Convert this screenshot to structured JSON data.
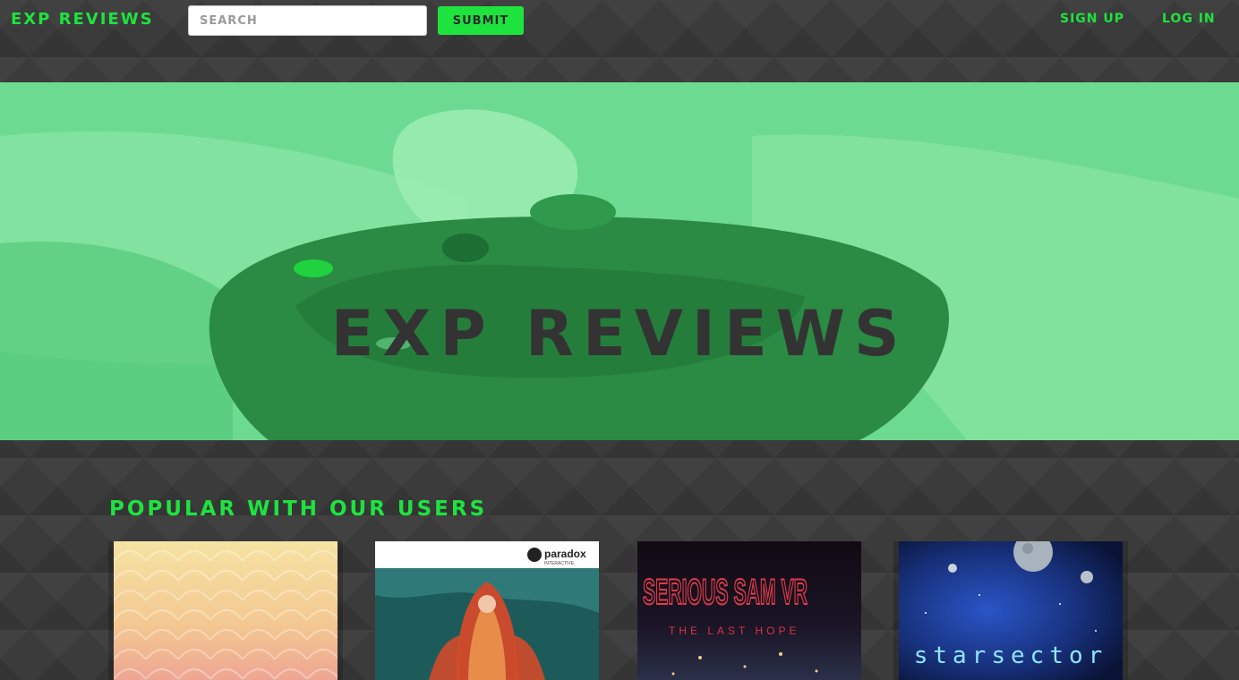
{
  "nav": {
    "brand": "EXP REVIEWS",
    "search_placeholder": "SEARCH",
    "submit_label": "SUBMIT",
    "signup_label": "SIGN UP",
    "login_label": "LOG IN"
  },
  "hero": {
    "title": "EXP REVIEWS"
  },
  "popular": {
    "heading": "POPULAR WITH OUR USERS",
    "games": [
      {
        "title": "",
        "art": "pastel-scales-cover"
      },
      {
        "title": "",
        "publisher": "paradox",
        "publisher_sub": "INTERACTIVE",
        "art": "red-haired-warrior-cover"
      },
      {
        "title": "SERIOUS SAM VR",
        "subtitle": "THE LAST HOPE",
        "art": "serious-sam-vr-cover"
      },
      {
        "title": "starsector",
        "art": "space-planets-cover"
      }
    ]
  },
  "colors": {
    "accent": "#1ee33f",
    "background": "#3b3b3b",
    "hero_text": "#333333"
  }
}
